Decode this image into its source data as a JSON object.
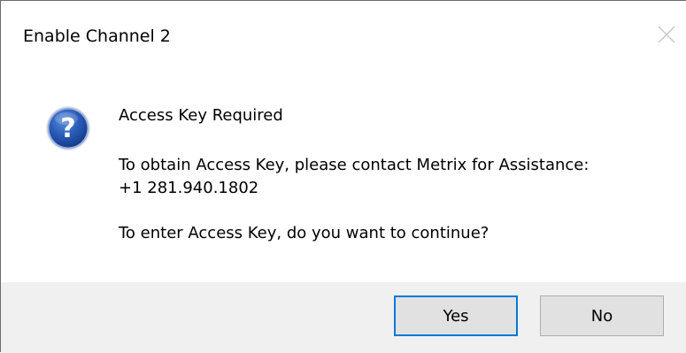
{
  "window": {
    "title": "Enable Channel 2",
    "close_icon": "close-icon"
  },
  "message": {
    "icon": "question-icon",
    "heading": "Access Key Required",
    "line1": "To obtain Access Key, please contact Metrix for Assistance:",
    "line2": "+1 281.940.1802",
    "question": "To enter Access Key, do you want to continue?"
  },
  "buttons": {
    "yes_label": "Yes",
    "no_label": "No"
  },
  "colors": {
    "focus_border": "#0078d7",
    "footer_bg": "#f0f0f0",
    "button_bg": "#e1e1e1",
    "icon_blue": "#1f4fa8"
  }
}
